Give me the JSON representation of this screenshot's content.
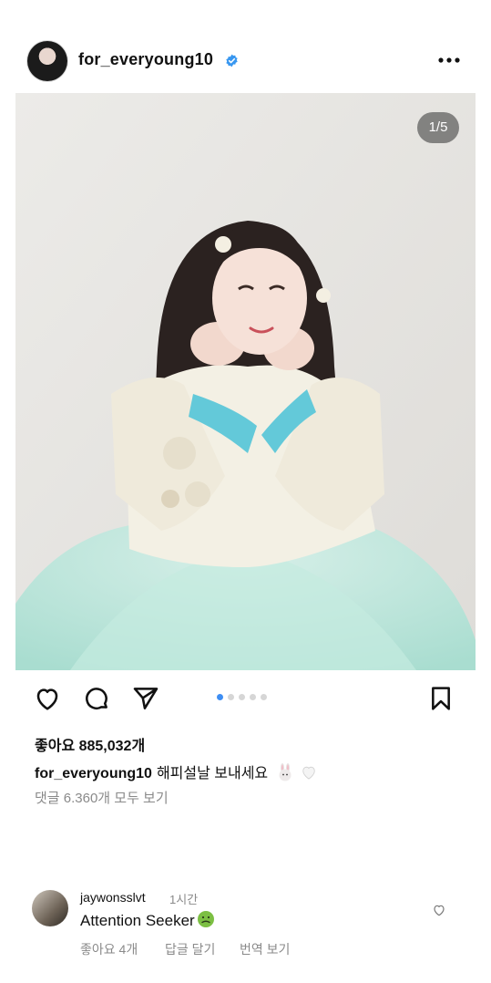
{
  "post": {
    "username": "for_everyoung10",
    "image_counter": "1/5",
    "carousel_total": 5,
    "carousel_active": 1,
    "likes": "좋아요 885,032개",
    "caption_user": "for_everyoung10",
    "caption_text": "해피설날 보내세요",
    "caption_emojis": [
      "rabbit-emoji",
      "white-heart-emoji"
    ],
    "view_comments": "댓글 6.360개 모두 보기"
  },
  "comment": {
    "username": "jaywonsslvt",
    "time": "1시간",
    "text": "Attention Seeker",
    "emoji": "nauseated-face-emoji",
    "likes": "좋아요 4개",
    "reply": "답글 달기",
    "translate": "번역 보기"
  },
  "icons": {
    "actions": [
      "heart-icon",
      "comment-icon",
      "share-icon",
      "bookmark-icon"
    ],
    "header": [
      "verified-badge-icon",
      "more-icon"
    ]
  },
  "colors": {
    "verified": "#3897f0",
    "active_dot": "#3e8ef3",
    "secondary_text": "#8a8a8a",
    "cuff_blue": "#63c9d9",
    "skirt_mint": "#bfe7dc"
  }
}
